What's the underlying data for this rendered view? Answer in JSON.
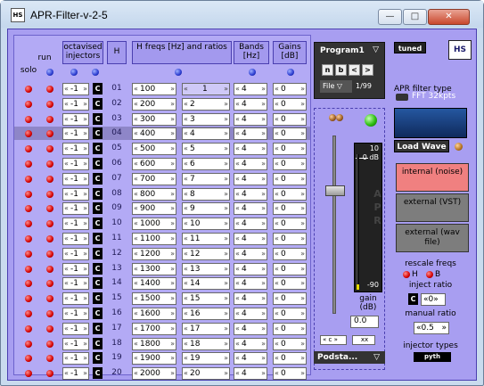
{
  "window": {
    "title": "APR-Filter-v-2-5",
    "app_icon": "HS",
    "minimize": "—",
    "maximize": "□",
    "close": "✕"
  },
  "grid": {
    "headers": {
      "run": "run",
      "octavised": "octavised injectors",
      "h": "H",
      "hfreqs": "H freqs [Hz] and ratios",
      "bands": "Bands [Hz]",
      "gains": "Gains [dB]",
      "solo": "solo"
    },
    "ratio_label_1": "1",
    "rows": [
      {
        "n": "01",
        "oct": "-1",
        "freq": "100",
        "ratio": "1",
        "band": "4",
        "gain": "0"
      },
      {
        "n": "02",
        "oct": "-1",
        "freq": "200",
        "ratio": "2",
        "band": "4",
        "gain": "0"
      },
      {
        "n": "03",
        "oct": "-1",
        "freq": "300",
        "ratio": "3",
        "band": "4",
        "gain": "0"
      },
      {
        "n": "04",
        "oct": "-1",
        "freq": "400",
        "ratio": "4",
        "band": "4",
        "gain": "0"
      },
      {
        "n": "05",
        "oct": "-1",
        "freq": "500",
        "ratio": "5",
        "band": "4",
        "gain": "0"
      },
      {
        "n": "06",
        "oct": "-1",
        "freq": "600",
        "ratio": "6",
        "band": "4",
        "gain": "0"
      },
      {
        "n": "07",
        "oct": "-1",
        "freq": "700",
        "ratio": "7",
        "band": "4",
        "gain": "0"
      },
      {
        "n": "08",
        "oct": "-1",
        "freq": "800",
        "ratio": "8",
        "band": "4",
        "gain": "0"
      },
      {
        "n": "09",
        "oct": "-1",
        "freq": "900",
        "ratio": "9",
        "band": "4",
        "gain": "0"
      },
      {
        "n": "10",
        "oct": "-1",
        "freq": "1000",
        "ratio": "10",
        "band": "4",
        "gain": "0"
      },
      {
        "n": "11",
        "oct": "-1",
        "freq": "1100",
        "ratio": "11",
        "band": "4",
        "gain": "0"
      },
      {
        "n": "12",
        "oct": "-1",
        "freq": "1200",
        "ratio": "12",
        "band": "4",
        "gain": "0"
      },
      {
        "n": "13",
        "oct": "-1",
        "freq": "1300",
        "ratio": "13",
        "band": "4",
        "gain": "0"
      },
      {
        "n": "14",
        "oct": "-1",
        "freq": "1400",
        "ratio": "14",
        "band": "4",
        "gain": "0"
      },
      {
        "n": "15",
        "oct": "-1",
        "freq": "1500",
        "ratio": "15",
        "band": "4",
        "gain": "0"
      },
      {
        "n": "16",
        "oct": "-1",
        "freq": "1600",
        "ratio": "16",
        "band": "4",
        "gain": "0"
      },
      {
        "n": "17",
        "oct": "-1",
        "freq": "1700",
        "ratio": "17",
        "band": "4",
        "gain": "0"
      },
      {
        "n": "18",
        "oct": "-1",
        "freq": "1800",
        "ratio": "18",
        "band": "4",
        "gain": "0"
      },
      {
        "n": "19",
        "oct": "-1",
        "freq": "1900",
        "ratio": "19",
        "band": "4",
        "gain": "0"
      },
      {
        "n": "20",
        "oct": "-1",
        "freq": "2000",
        "ratio": "20",
        "band": "4",
        "gain": "0"
      }
    ],
    "c_label": "C",
    "arrow_left": "«",
    "arrow_right": "»"
  },
  "program": {
    "name": "Program1",
    "chevron": "▽",
    "btn_n": "n",
    "btn_b": "b",
    "btn_prev": "<",
    "btn_next": ">",
    "file": "File ▽",
    "count": "1/99"
  },
  "gain": {
    "meter_top": "10",
    "meter_zero": "0 dB",
    "meter_bottom": "-90",
    "apr_label": "APR",
    "label": "gain (dB)",
    "value": "0.0",
    "c_btn": "« c »",
    "xx": "xx",
    "podsta": "Podsta...",
    "podsta_chevron": "▽"
  },
  "right": {
    "tuned": "tuned",
    "logo": "HS",
    "filter_type_label": "APR filter type",
    "fft": "FFT 32kpts",
    "load_wave": "Load Wave",
    "sources": [
      {
        "label": "internal (noise)",
        "active": true
      },
      {
        "label": "external (VST)",
        "active": false
      },
      {
        "label": "external (wav file)",
        "active": false
      }
    ],
    "rescale_label": "rescale freqs",
    "rescale_h": "H",
    "rescale_b": "B",
    "inject_ratio_label": "inject ratio",
    "inject_ratio_c": "C",
    "inject_ratio_value": "0",
    "manual_ratio_label": "manual ratio",
    "manual_ratio_value": "0.5",
    "injector_types_label": "injector types",
    "injector_type_value": "pyth"
  },
  "colors": {
    "panel": "#a89ef1",
    "active_source": "#f08080",
    "inactive_source": "#7d7d7d"
  }
}
